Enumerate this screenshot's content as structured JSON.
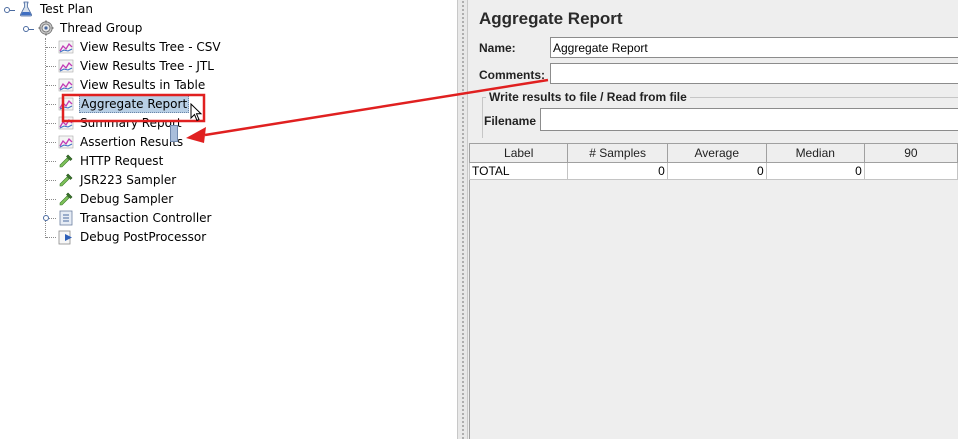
{
  "tree": {
    "root": {
      "label": "Test Plan",
      "icon": "flask-icon"
    },
    "thread_group": {
      "label": "Thread Group",
      "icon": "gear-icon"
    },
    "children": [
      {
        "label": "View Results Tree - CSV",
        "icon": "chart-icon",
        "selected": false
      },
      {
        "label": "View Results Tree - JTL",
        "icon": "chart-icon",
        "selected": false
      },
      {
        "label": "View Results in Table",
        "icon": "chart-icon",
        "selected": false
      },
      {
        "label": "Aggregate Report",
        "icon": "chart-icon",
        "selected": true
      },
      {
        "label": "Summary Report",
        "icon": "chart-icon",
        "selected": false
      },
      {
        "label": "Assertion Results",
        "icon": "chart-icon",
        "selected": false
      },
      {
        "label": "HTTP Request",
        "icon": "pipette-icon",
        "selected": false
      },
      {
        "label": "JSR223 Sampler",
        "icon": "pipette-icon",
        "selected": false
      },
      {
        "label": "Debug Sampler",
        "icon": "pipette-icon",
        "selected": false
      },
      {
        "label": "Transaction Controller",
        "icon": "controller-icon",
        "selected": false,
        "expandable": true
      },
      {
        "label": "Debug PostProcessor",
        "icon": "postprocessor-icon",
        "selected": false
      }
    ]
  },
  "panel": {
    "title": "Aggregate Report",
    "name_label": "Name:",
    "name_value": "Aggregate Report",
    "comments_label": "Comments:",
    "comments_value": "",
    "file_group_title": "Write results to file / Read from file",
    "filename_label": "Filename",
    "filename_value": ""
  },
  "table": {
    "columns": [
      "Label",
      "# Samples",
      "Average",
      "Median",
      "90"
    ],
    "rows": [
      [
        "TOTAL",
        "0",
        "0",
        "0",
        ""
      ]
    ]
  },
  "colors": {
    "annotation": "#e02020",
    "selection": "#b8cfe5",
    "panel_bg": "#eeeeee"
  }
}
